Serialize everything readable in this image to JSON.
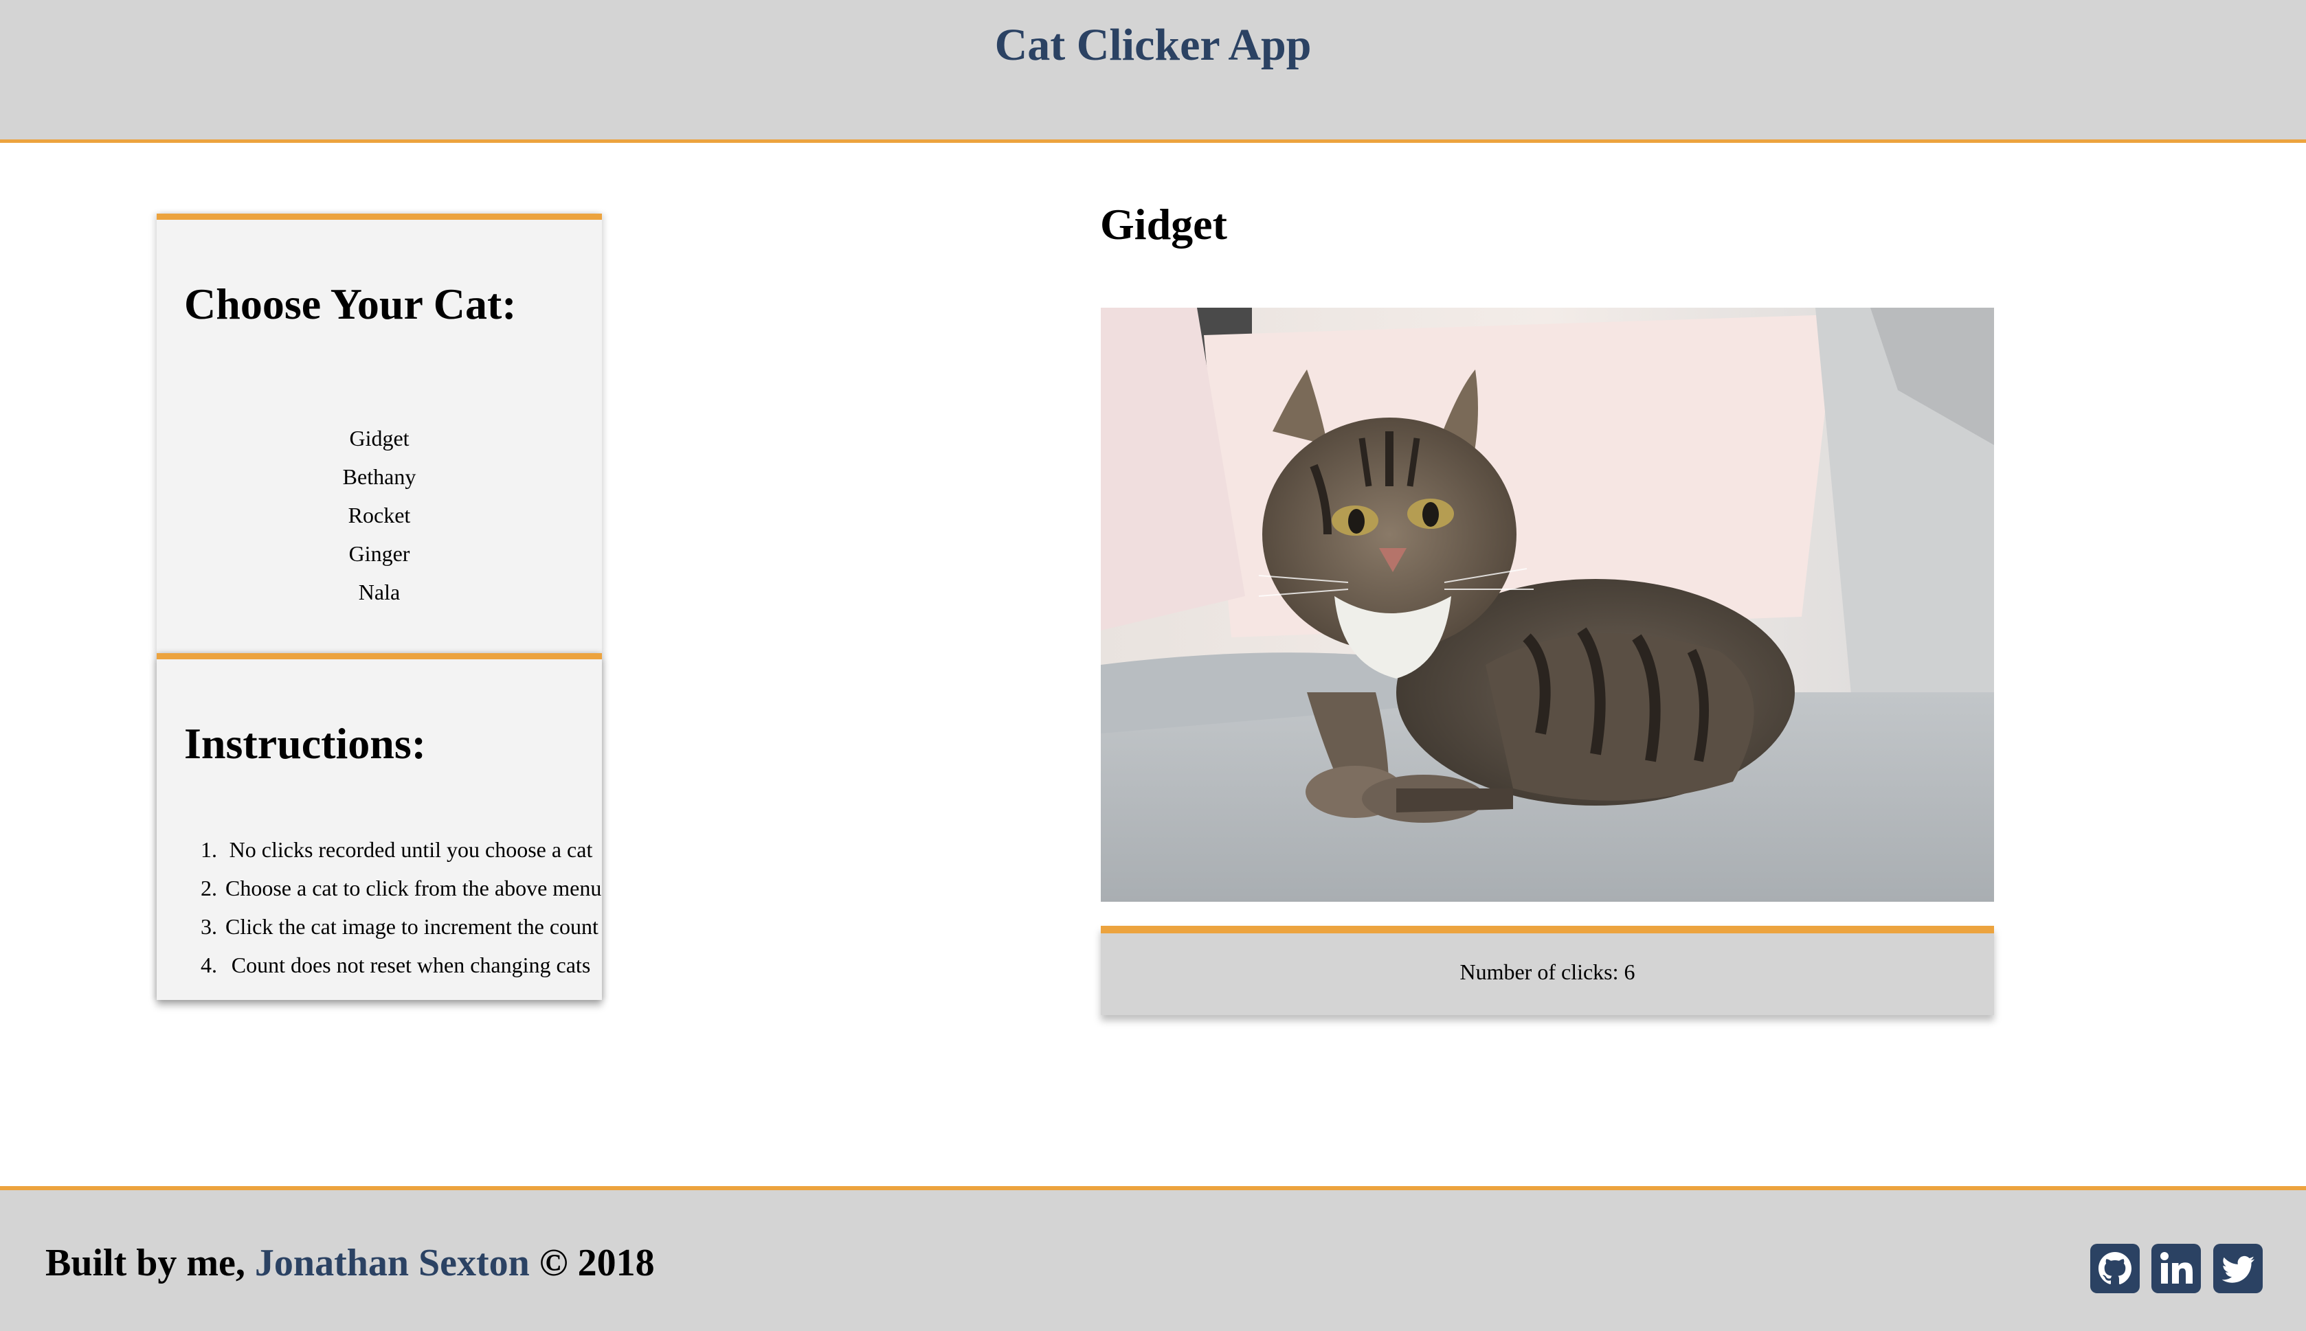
{
  "header": {
    "title": "Cat Clicker App"
  },
  "cat_menu": {
    "heading": "Choose Your Cat:",
    "cats": [
      "Gidget",
      "Bethany",
      "Rocket",
      "Ginger",
      "Nala"
    ]
  },
  "instructions": {
    "heading": "Instructions:",
    "items": [
      {
        "num": "1.",
        "text": "No clicks recorded until you choose a cat"
      },
      {
        "num": "2.",
        "text": "Choose a cat to click from the above menu"
      },
      {
        "num": "3.",
        "text": "Click the cat image to increment the count"
      },
      {
        "num": "4.",
        "text": "Count does not reset when changing cats"
      }
    ]
  },
  "main": {
    "cat_name": "Gidget",
    "clicks_label": "Number of clicks: 6"
  },
  "footer": {
    "prefix": "Built by me, ",
    "author": "Jonathan Sexton",
    "suffix": " © 2018",
    "social": [
      {
        "icon": "github-icon"
      },
      {
        "icon": "linkedin-icon"
      },
      {
        "icon": "twitter-icon"
      }
    ]
  },
  "colors": {
    "accent": "#eca33e",
    "brand": "#2b4263",
    "bar": "#d4d4d4",
    "panel": "#f3f3f3"
  }
}
